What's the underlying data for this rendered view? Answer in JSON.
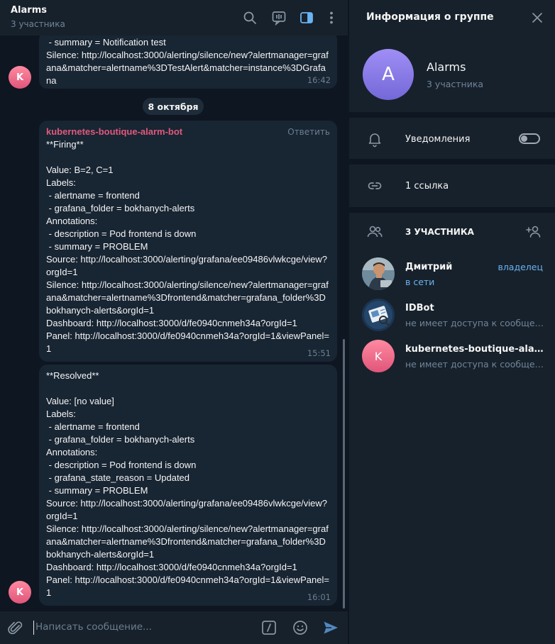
{
  "chat": {
    "title": "Alarms",
    "subtitle": "3 участника",
    "date_divider": "8 октября",
    "messages": [
      {
        "avatar": "K",
        "text": " - summary = Notification test\nSilence: http://localhost:3000/alerting/silence/new?alertmanager=grafana&matcher=alertname%3DTestAlert&matcher=instance%3DGrafana",
        "time": "16:42"
      },
      {
        "sender": "kubernetes-boutique-alarm-bot",
        "reply": "Ответить",
        "text": "**Firing**\n\nValue: B=2, C=1\nLabels:\n - alertname = frontend\n - grafana_folder = bokhanych-alerts\nAnnotations:\n - description = Pod frontend is down\n - summary = PROBLEM\nSource: http://localhost:3000/alerting/grafana/ee09486vlwkcge/view?orgId=1\nSilence: http://localhost:3000/alerting/silence/new?alertmanager=grafana&matcher=alertname%3Dfrontend&matcher=grafana_folder%3Dbokhanych-alerts&orgId=1\nDashboard: http://localhost:3000/d/fe0940cnmeh34a?orgId=1\nPanel: http://localhost:3000/d/fe0940cnmeh34a?orgId=1&viewPanel=1",
        "time": "15:51"
      },
      {
        "avatar": "K",
        "text": "**Resolved**\n\nValue: [no value]\nLabels:\n - alertname = frontend\n - grafana_folder = bokhanych-alerts\nAnnotations:\n - description = Pod frontend is down\n - grafana_state_reason = Updated\n - summary = PROBLEM\nSource: http://localhost:3000/alerting/grafana/ee09486vlwkcge/view?orgId=1\nSilence: http://localhost:3000/alerting/silence/new?alertmanager=grafana&matcher=alertname%3Dfrontend&matcher=grafana_folder%3Dbokhanych-alerts&orgId=1\nDashboard: http://localhost:3000/d/fe0940cnmeh34a?orgId=1\nPanel: http://localhost:3000/d/fe0940cnmeh34a?orgId=1&viewPanel=1",
        "time": "16:01"
      }
    ],
    "composer_placeholder": "Написать сообщение..."
  },
  "panel": {
    "title": "Информация о группе",
    "group_avatar": "A",
    "group_name": "Alarms",
    "group_sub": "3 участника",
    "notifications_label": "Уведомления",
    "notifications_on": false,
    "links_label": "1 ссылка",
    "members_title": "3 УЧАСТНИКА",
    "members": [
      {
        "name": "Дмитрий",
        "status": "в сети",
        "role": "владелец"
      },
      {
        "name": "IDBot",
        "status": "не имеет доступа к сообщениям"
      },
      {
        "avatar": "K",
        "name": "kubernetes-boutique-alarm-bot",
        "status": "не имеет доступа к сообщениям"
      }
    ]
  },
  "colors": {
    "background": "#0e1621",
    "panel": "#17212b",
    "bubble": "#182533",
    "accent": "#6ab3f3",
    "sender": "#e0597c"
  },
  "icons": [
    "search-icon",
    "video-chat-icon",
    "sidebar-toggle-icon",
    "more-icon",
    "close-icon",
    "bell-icon",
    "link-icon",
    "members-icon",
    "add-member-icon",
    "attach-icon",
    "command-icon",
    "emoji-icon",
    "send-icon"
  ]
}
